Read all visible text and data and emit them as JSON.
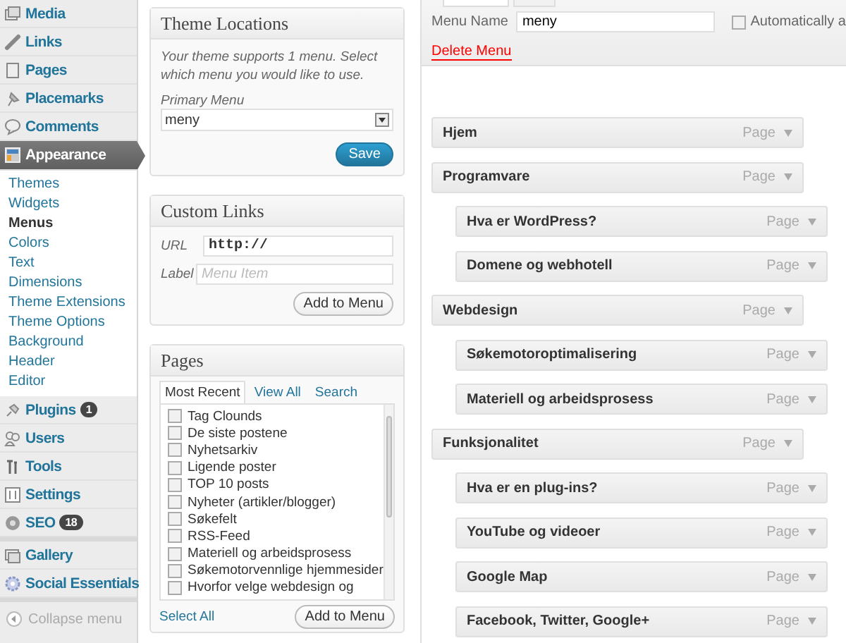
{
  "sidebar": {
    "groups": [
      [
        {
          "label": "Media",
          "selected": false
        },
        {
          "label": "Links",
          "selected": false
        },
        {
          "label": "Pages",
          "selected": false
        },
        {
          "label": "Placemarks",
          "selected": false
        },
        {
          "label": "Comments",
          "selected": false
        },
        {
          "label": "Appearance",
          "selected": true,
          "children": [
            {
              "label": "Themes",
              "selected": false
            },
            {
              "label": "Widgets",
              "selected": false
            },
            {
              "label": "Menus",
              "selected": true
            },
            {
              "label": "Colors",
              "selected": false
            },
            {
              "label": "Text",
              "selected": false
            },
            {
              "label": "Dimensions",
              "selected": false
            },
            {
              "label": "Theme Extensions",
              "selected": false
            },
            {
              "label": "Theme Options",
              "selected": false
            },
            {
              "label": "Background",
              "selected": false
            },
            {
              "label": "Header",
              "selected": false
            },
            {
              "label": "Editor",
              "selected": false
            }
          ]
        },
        {
          "label": "Plugins",
          "selected": false,
          "badge": "1"
        },
        {
          "label": "Users",
          "selected": false
        },
        {
          "label": "Tools",
          "selected": false
        },
        {
          "label": "Settings",
          "selected": false
        },
        {
          "label": "SEO",
          "selected": false,
          "badge": "18"
        }
      ],
      [
        {
          "label": "Gallery",
          "selected": false
        },
        {
          "label": "Social Essentials",
          "selected": false
        }
      ]
    ],
    "collapse": "Collapse menu"
  },
  "theme_locations": {
    "title": "Theme Locations",
    "description": "Your theme supports 1 menu. Select which menu you would like to use.",
    "field_label": "Primary Menu",
    "value": "meny",
    "button": "Save"
  },
  "custom_links": {
    "title": "Custom Links",
    "url_label": "URL",
    "url_value": "http://",
    "label_label": "Label",
    "label_placeholder": "Menu Item",
    "button": "Add to Menu"
  },
  "pages": {
    "title": "Pages",
    "tabs": [
      {
        "label": "Most Recent",
        "selected": true
      },
      {
        "label": "View All",
        "selected": false
      },
      {
        "label": "Search",
        "selected": false
      }
    ],
    "items": [
      {
        "label": "Tag Clounds",
        "checked": false
      },
      {
        "label": "De siste postene",
        "checked": false
      },
      {
        "label": "Nyhetsarkiv",
        "checked": false
      },
      {
        "label": "Ligende poster",
        "checked": false
      },
      {
        "label": "TOP 10 posts",
        "checked": false
      },
      {
        "label": "Nyheter (artikler/blogger)",
        "checked": false
      },
      {
        "label": "Søkefelt",
        "checked": false
      },
      {
        "label": "RSS-Feed",
        "checked": false
      },
      {
        "label": "Materiell og arbeidsprosess",
        "checked": false
      },
      {
        "label": "Søkemotorvennlige hjemmesider",
        "checked": false
      },
      {
        "label": "Hvorfor velge webdesign og",
        "checked": false
      }
    ],
    "select_all": "Select All",
    "button": "Add to Menu"
  },
  "menu_editor": {
    "name_label": "Menu Name",
    "name_value": "meny",
    "auto_add_label": "Automatically a",
    "auto_add_checked": false,
    "delete": "Delete Menu",
    "items": [
      {
        "title": "Hjem",
        "type": "Page"
      },
      {
        "title": "Programvare",
        "type": "Page",
        "children": [
          {
            "title": "Hva er WordPress?",
            "type": "Page"
          },
          {
            "title": "Domene og webhotell",
            "type": "Page"
          }
        ]
      },
      {
        "title": "Webdesign",
        "type": "Page",
        "children": [
          {
            "title": "Søkemotoroptimalisering",
            "type": "Page"
          },
          {
            "title": "Materiell og arbeidsprosess",
            "type": "Page"
          }
        ]
      },
      {
        "title": "Funksjonalitet",
        "type": "Page",
        "children": [
          {
            "title": "Hva er en plug-ins?",
            "type": "Page"
          },
          {
            "title": "YouTube og videoer",
            "type": "Page"
          },
          {
            "title": "Google Map",
            "type": "Page"
          },
          {
            "title": "Facebook, Twitter, Google+",
            "type": "Page"
          }
        ]
      }
    ]
  }
}
